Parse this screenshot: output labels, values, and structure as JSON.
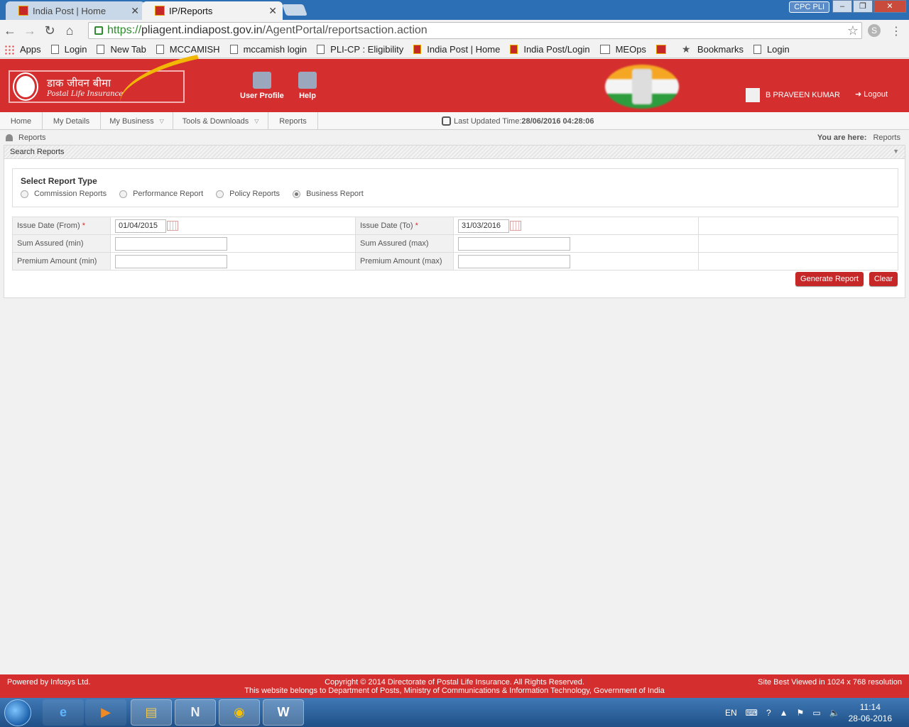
{
  "browser": {
    "tabs": [
      {
        "title": "India Post | Home",
        "active": false
      },
      {
        "title": "IP/Reports",
        "active": true
      }
    ],
    "window_user": "CPC PLI",
    "url_scheme": "https://",
    "url_host": "pliagent.indiapost.gov.in",
    "url_path": "/AgentPortal/reportsaction.action",
    "bookmarks": [
      {
        "label": "Apps",
        "icon": "apps-icon"
      },
      {
        "label": "Login",
        "icon": "page-icon"
      },
      {
        "label": "New Tab",
        "icon": "page-icon"
      },
      {
        "label": "MCCAMISH",
        "icon": "page-icon"
      },
      {
        "label": "mccamish login",
        "icon": "page-icon"
      },
      {
        "label": "PLI-CP : Eligibility",
        "icon": "page-icon"
      },
      {
        "label": "India Post | Home",
        "icon": "indiapost-icon"
      },
      {
        "label": "India Post/Login",
        "icon": "indiapost-icon"
      },
      {
        "label": "MEOps",
        "icon": "meops-icon"
      },
      {
        "label": "",
        "icon": "act-icon"
      },
      {
        "label": "Bookmarks",
        "icon": "star-icon"
      },
      {
        "label": "Login",
        "icon": "page-icon"
      }
    ]
  },
  "header": {
    "logo_hindi": "डाक जीवन बीमा",
    "logo_english": "Postal Life Insurance",
    "user_profile": "User Profile",
    "help": "Help",
    "user_name": "B PRAVEEN KUMAR",
    "logout": "Logout"
  },
  "menu": {
    "items": [
      {
        "label": "Home",
        "dropdown": false
      },
      {
        "label": "My Details",
        "dropdown": false
      },
      {
        "label": "My Business",
        "dropdown": true
      },
      {
        "label": "Tools & Downloads",
        "dropdown": true
      },
      {
        "label": "Reports",
        "dropdown": false
      }
    ],
    "last_updated_label": "Last Updated Time:",
    "last_updated_value": "28/06/2016 04:28:06"
  },
  "breadcrumb": {
    "page": "Reports",
    "you_are_here": "You are here:",
    "current": "Reports"
  },
  "panel": {
    "title": "Search Reports",
    "report_type_title": "Select Report Type",
    "report_types": [
      {
        "label": "Commission Reports",
        "selected": false
      },
      {
        "label": "Performance Report",
        "selected": false
      },
      {
        "label": "Policy Reports",
        "selected": false
      },
      {
        "label": "Business Report",
        "selected": true
      }
    ],
    "fields": {
      "issue_from_label": "Issue Date (From)",
      "issue_from_value": "01/04/2015",
      "issue_to_label": "Issue Date (To)",
      "issue_to_value": "31/03/2016",
      "sum_min_label": "Sum Assured (min)",
      "sum_min_value": "",
      "sum_max_label": "Sum Assured (max)",
      "sum_max_value": "",
      "prem_min_label": "Premium Amount (min)",
      "prem_min_value": "",
      "prem_max_label": "Premium Amount (max)",
      "prem_max_value": "",
      "required_mark": "*"
    },
    "generate_button": "Generate Report",
    "clear_button": "Clear"
  },
  "footer": {
    "powered_by": "Powered by Infosys Ltd.",
    "copyright": "Copyright © 2014 Directorate of Postal Life Insurance. All Rights Reserved.",
    "belongs": "This website belongs to Department of Posts, Ministry of Communications & Information Technology, Government of India",
    "best_viewed": "Site Best Viewed in 1024 x 768 resolution"
  },
  "taskbar": {
    "language": "EN",
    "time": "11:14",
    "date": "28-06-2016"
  },
  "colors": {
    "brand_red": "#d42e2e",
    "button_red": "#c62828",
    "secure_green": "#2e8b2e"
  }
}
